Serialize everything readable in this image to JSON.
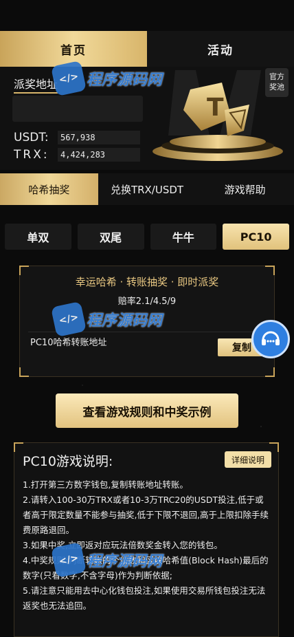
{
  "nav": {
    "tabs": [
      {
        "label": "首页",
        "active": true
      },
      {
        "label": "活动",
        "active": false
      }
    ]
  },
  "header": {
    "prize_title": "派奖地址",
    "pool_badge": "官方\n奖池",
    "usdt_label": "USDT:",
    "usdt_value": "567,938",
    "trx_label": "TRX:",
    "trx_value": "4,424,283"
  },
  "sub_tabs": [
    {
      "label": "哈希抽奖",
      "active": true
    },
    {
      "label": "兑换TRX/USDT",
      "active": false
    },
    {
      "label": "游戏帮助",
      "active": false
    }
  ],
  "game_tabs": [
    {
      "label": "单双"
    },
    {
      "label": "双尾"
    },
    {
      "label": "牛牛"
    },
    {
      "label": "PC10"
    }
  ],
  "card": {
    "slogan": "幸运哈希 · 转账抽奖 · 即时派奖",
    "odds": "赔率2.1/4.5/9",
    "address_label": "PC10哈希转账地址",
    "copy_label": "复制"
  },
  "rules_button": "查看游戏规则和中奖示例",
  "description": {
    "title": "PC10游戏说明:",
    "detail_button": "详细说明",
    "items": [
      "1.打开第三方数字钱包,复制转账地址转账。",
      "2.请转入100-30万TRX或者10-3万TRC20的USDT投注,低于或者高于限定数量不能参与抽奖,低于下限不退回,高于上限扣除手续费原路退回。",
      "3.如果中奖,立即返对应玩法倍数奖金转入您的钱包。",
      "4.中奖规则:判断转账的个位数和区块哈希值(Block Hash)最后的数字(只看数字,不含字母)作为判断依据;",
      "5.请注意只能用去中心化钱包投注,如果使用交易所钱包投注无法返奖也无法追回。"
    ]
  },
  "watermark": "程序源码网",
  "colors": {
    "gold": "#e1c27c",
    "gold_light": "#f7e3ae",
    "bg": "#0b0b0b",
    "support_blue": "#2f7fe0"
  }
}
